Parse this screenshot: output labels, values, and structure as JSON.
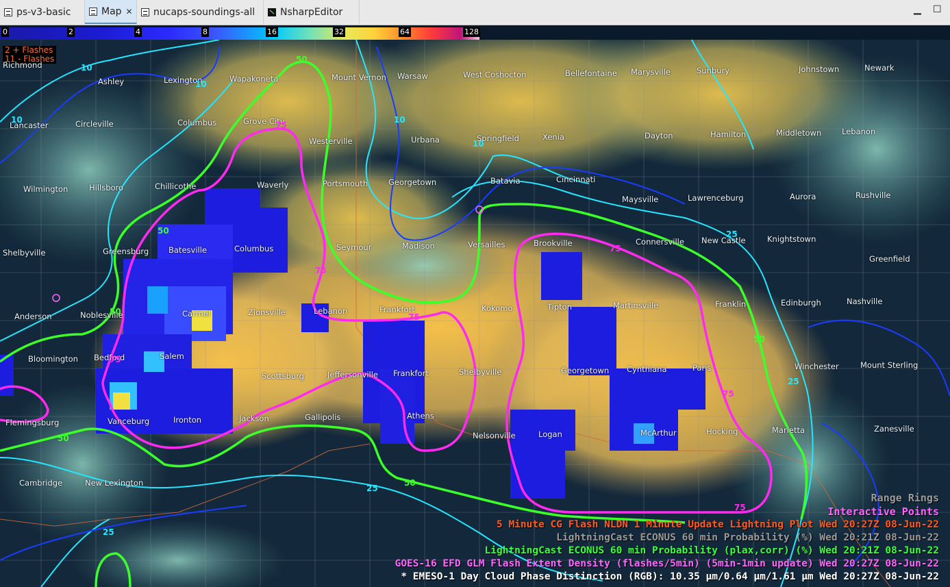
{
  "tabs": [
    {
      "label": "ps-v3-basic",
      "icon": "display-icon",
      "active": false
    },
    {
      "label": "Map",
      "icon": "display-icon",
      "active": true
    },
    {
      "label": "nucaps-soundings-all",
      "icon": "display-icon",
      "active": false
    },
    {
      "label": "NsharpEditor",
      "icon": "nsharp-icon",
      "active": false
    }
  ],
  "window_controls": {
    "minimize": "▁",
    "maximize": "☐"
  },
  "colorbar": {
    "ticks": [
      "0",
      "2",
      "4",
      "8",
      "16",
      "32",
      "64",
      "128"
    ]
  },
  "flash_legend": {
    "line1": "2 + Flashes",
    "line2": "11 - Flashes",
    "line1_color": "#ff6a3a",
    "line2_color": "#ff6a3a"
  },
  "place_labels": [
    "Richmond",
    "Ashley",
    "Lexington",
    "Wapakoneta",
    "Mount Vernon",
    "Warsaw",
    "West Coshocton",
    "Bellefontaine",
    "Marysville",
    "Sunbury",
    "Johnstown",
    "Newark",
    "Lancaster",
    "Circleville",
    "Columbus",
    "Grove City",
    "Westerville",
    "Urbana",
    "Springfield",
    "Xenia",
    "Dayton",
    "Hamilton",
    "Middletown",
    "Lebanon",
    "Wilmington",
    "Hillsboro",
    "Chillicothe",
    "Waverly",
    "Portsmouth",
    "Georgetown",
    "Batavia",
    "Cincinnati",
    "Maysville",
    "Lawrenceburg",
    "Aurora",
    "Rushville",
    "Shelbyville",
    "Greensburg",
    "Batesville",
    "Columbus",
    "Seymour",
    "Madison",
    "Versailles",
    "Brookville",
    "Connersville",
    "New Castle",
    "Knightstown",
    "Greenfield",
    "Anderson",
    "Noblesville",
    "Carmel",
    "Zionsville",
    "Lebanon",
    "Frankfort",
    "Kokomo",
    "Tipton",
    "Martinsville",
    "Franklin",
    "Edinburgh",
    "Nashville",
    "Bloomington",
    "Bedford",
    "Salem",
    "Scottsburg",
    "Jeffersonville",
    "Frankfort",
    "Shelbyville",
    "Georgetown",
    "Cynthiana",
    "Paris",
    "Winchester",
    "Mount Sterling",
    "Flemingsburg",
    "Vanceburg",
    "Ironton",
    "Jackson",
    "Gallipolis",
    "Athens",
    "Nelsonville",
    "Logan",
    "McArthur",
    "Hocking",
    "Marietta",
    "Zanesville",
    "Cambridge",
    "New Lexington"
  ],
  "contour_labels": {
    "cyan": "10",
    "cyan_alt": "25",
    "green": "50",
    "magenta": "75"
  },
  "overlay_labels": {
    "range_rings": "Range Rings",
    "interactive_points": "Interactive Points"
  },
  "legend": [
    {
      "text": "5 Minute CG Flash NLDN 1 Minute Update Lightning Plot   Wed 20:27Z 08-Jun-22",
      "color": "#ff5a1f"
    },
    {
      "text": "LightningCast ECONUS 60 min Probability (%)   Wed 20:21Z 08-Jun-22",
      "color": "#9a9a9a"
    },
    {
      "text": "LightningCast ECONUS 60 min Probability (plax,corr) (%)   Wed 20:21Z 08-Jun-22",
      "color": "#3cff3c"
    },
    {
      "text": "GOES-16 EFD GLM Flash Extent Density (flashes/5min) (5min-1min update)   Wed 20:27Z 08-Jun-22",
      "color": "#ff66ff"
    },
    {
      "text": "* EMESO-1 Day Cloud Phase Distinction (RGB): 10.35 µm/0.64 µm/1.61 µm Wed 20:27Z 08-Jun-22",
      "color": "#ffffff"
    }
  ]
}
